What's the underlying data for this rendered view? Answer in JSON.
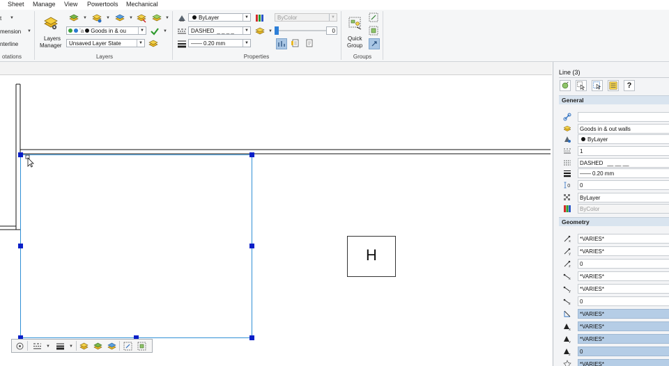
{
  "menu": {
    "items": [
      "Sheet",
      "Manage",
      "View",
      "Powertools",
      "Mechanical"
    ]
  },
  "ribbon": {
    "annotations": {
      "items": [
        "t",
        "mension",
        "nterline"
      ],
      "label": "otations"
    },
    "layers": {
      "manager_label_line1": "Layers",
      "manager_label_line2": "Manager",
      "current_layer": "Goods in & ou",
      "layer_state": "Unsaved Layer State",
      "label": "Layers"
    },
    "properties": {
      "color": "ByLayer",
      "linetype": "DASHED",
      "lineweight": "0.20 mm",
      "plotstyle": "ByColor",
      "transparency_value": "0",
      "label": "Properties"
    },
    "groups": {
      "quick_group_line1": "Quick",
      "quick_group_line2": "Group",
      "label": "Groups"
    }
  },
  "drawing": {
    "text_box_label": "H"
  },
  "properties_panel": {
    "selection_title": "Line (3)",
    "general": {
      "header": "General",
      "rows": [
        {
          "icon": "hyperlink-icon",
          "value": ""
        },
        {
          "icon": "layer-icon",
          "value": "Goods in & out walls"
        },
        {
          "icon": "color-icon",
          "value": "ByLayer"
        },
        {
          "icon": "linetype-scale-icon",
          "value": "1"
        },
        {
          "icon": "linetype-icon",
          "value": "DASHED"
        },
        {
          "icon": "lineweight-icon",
          "value": "0.20 mm"
        },
        {
          "icon": "thickness-icon",
          "value": "0"
        },
        {
          "icon": "transparency-icon",
          "value": "ByLayer"
        },
        {
          "icon": "plotstyle-icon",
          "value": "ByColor"
        }
      ]
    },
    "geometry": {
      "header": "Geometry",
      "rows": [
        {
          "icon": "start-x-icon",
          "value": "*VARIES*"
        },
        {
          "icon": "start-y-icon",
          "value": "*VARIES*"
        },
        {
          "icon": "start-z-icon",
          "value": "0"
        },
        {
          "icon": "end-x-icon",
          "value": "*VARIES*"
        },
        {
          "icon": "end-y-icon",
          "value": "*VARIES*"
        },
        {
          "icon": "end-z-icon",
          "value": "0"
        },
        {
          "icon": "length-icon",
          "value": "*VARIES*"
        },
        {
          "icon": "delta-x-icon",
          "value": "*VARIES*"
        },
        {
          "icon": "delta-y-icon",
          "value": "*VARIES*"
        },
        {
          "icon": "delta-z-icon",
          "value": "0"
        },
        {
          "icon": "angle-icon",
          "value": "*VARIES*"
        }
      ]
    }
  },
  "colors": {
    "selection_grip": "#0a1fc8",
    "selection_line": "#2f8fd5",
    "selected_row": "#b5cde6",
    "section_header": "#d9e4ef"
  }
}
